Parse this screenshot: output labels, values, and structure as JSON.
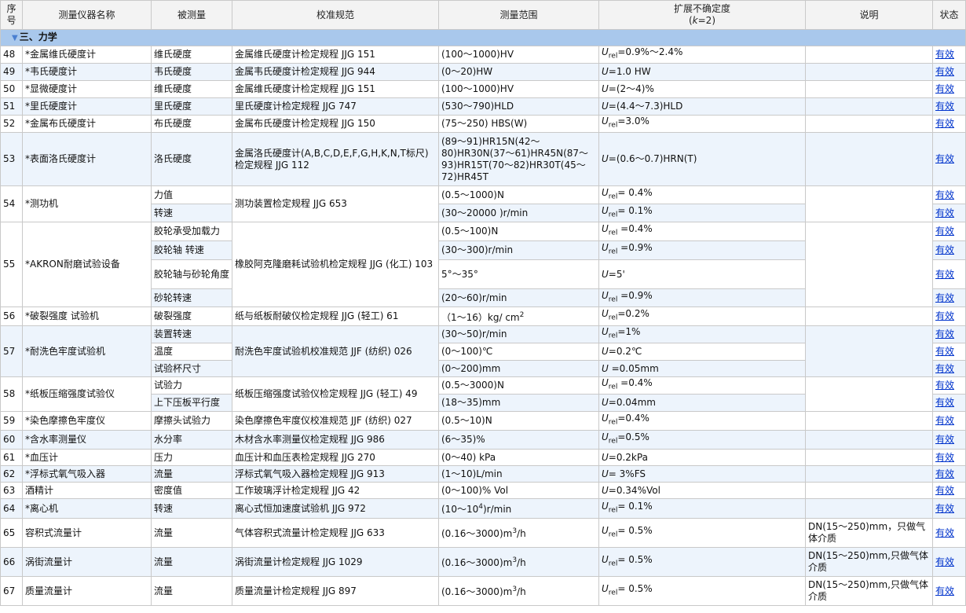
{
  "headers": [
    "序号",
    "测量仪器名称",
    "被测量",
    "校准规范",
    "测量范围",
    "扩展不确定度",
    "(k=2)",
    "说明",
    "状态"
  ],
  "section": "三、力学",
  "status_link": "有效",
  "rows": {
    "r48": {
      "no": "48",
      "name": "*金属维氏硬度计",
      "qty": "维氏硬度",
      "spec": "金属维氏硬度计检定规程 JJG 151",
      "range": "(100～1000)HV",
      "u": "=0.9%～2.4%"
    },
    "r49": {
      "no": "49",
      "name": "*韦氏硬度计",
      "qty": "韦氏硬度",
      "spec": "金属韦氏硬度计检定规程 JJG 944",
      "range": "(0～20)HW",
      "u": "=1.0 HW"
    },
    "r50": {
      "no": "50",
      "name": "*显微硬度计",
      "qty": "维氏硬度",
      "spec": "金属维氏硬度计检定规程 JJG 151",
      "range": "(100～1000)HV",
      "u": "=(2～4)%"
    },
    "r51": {
      "no": "51",
      "name": "*里氏硬度计",
      "qty": "里氏硬度",
      "spec": "里氏硬度计检定规程 JJG 747",
      "range": "(530～790)HLD",
      "u": "=(4.4～7.3)HLD"
    },
    "r52": {
      "no": "52",
      "name": "*金属布氏硬度计",
      "qty": "布氏硬度",
      "spec": "金属布氏硬度计检定规程 JJG 150",
      "range": "(75～250) HBS(W)",
      "u": "=3.0%"
    },
    "r53": {
      "no": "53",
      "name": "*表面洛氏硬度计",
      "qty": "洛氏硬度",
      "spec": "金属洛氏硬度计(A,B,C,D,E,F,G,H,K,N,T标尺)检定规程 JJG 112",
      "range": "(89～91)HR15N(42～80)HR30N(37～61)HR45N(87～93)HR15T(70～82)HR30T(45～72)HR45T",
      "u": "=(0.6～0.7)HRN(T)"
    },
    "r54": {
      "no": "54",
      "name": "*测功机",
      "spec": "测功装置检定规程 JJG 653",
      "subs": [
        {
          "qty": "力值",
          "range": "(0.5～1000)N",
          "u": "= 0.4%"
        },
        {
          "qty": "转速",
          "range": "(30～20000 )r/min",
          "u": "= 0.1%"
        }
      ]
    },
    "r55": {
      "no": "55",
      "name": "*AKRON耐磨试验设备",
      "spec": "橡胶阿克隆磨耗试验机检定规程 JJG (化工) 103",
      "subs": [
        {
          "qty": "胶轮承受加载力",
          "range": "(0.5～100)N",
          "u": " =0.4%"
        },
        {
          "qty": "胶轮轴 转速",
          "range": "(30～300)r/min",
          "u": " =0.9%"
        },
        {
          "qty": "胶轮轴与砂轮角度",
          "range": "5°～35°",
          "u": "=5'"
        },
        {
          "qty": "砂轮转速",
          "range": "(20～60)r/min",
          "u": " =0.9%"
        }
      ]
    },
    "r56": {
      "no": "56",
      "name": "*破裂强度 试验机",
      "qty": "破裂强度",
      "spec": "纸与纸板耐破仪检定规程 JJG (轻工) 61",
      "range": "（1～16）kg/ cm",
      "u": "=0.2%"
    },
    "r57": {
      "no": "57",
      "name": "*耐洗色牢度试验机",
      "spec": "耐洗色牢度试验机校准规范 JJF (纺织) 026",
      "subs": [
        {
          "qty": "装置转速",
          "range": "(30～50)r/min",
          "u": "=1%"
        },
        {
          "qty": "温度",
          "range": "(0～100)℃",
          "u": "=0.2℃"
        },
        {
          "qty": "试验杯尺寸",
          "range": "(0～200)mm",
          "u": " =0.05mm"
        }
      ]
    },
    "r58": {
      "no": "58",
      "name": "*纸板压缩强度试验仪",
      "spec": "纸板压缩强度试验仪检定规程 JJG (轻工) 49",
      "subs": [
        {
          "qty": "试验力",
          "range": "(0.5～3000)N",
          "u": " =0.4%"
        },
        {
          "qty": "上下压板平行度",
          "range": "(18～35)mm",
          "u": "=0.04mm"
        }
      ]
    },
    "r59": {
      "no": "59",
      "name": "*染色摩擦色牢度仪",
      "qty": "摩擦头试验力",
      "spec": "染色摩擦色牢度仪校准规范 JJF (纺织) 027",
      "range": "(0.5～10)N",
      "u": "=0.4%"
    },
    "r60": {
      "no": "60",
      "name": "*含水率测量仪",
      "qty": "水分率",
      "spec": "木材含水率测量仪检定规程 JJG 986",
      "range": "(6～35)%",
      "u": "=0.5%"
    },
    "r61": {
      "no": "61",
      "name": "*血压计",
      "qty": "压力",
      "spec": "血压计和血压表检定规程 JJG 270",
      "range": "(0～40) kPa",
      "u": "=0.2kPa"
    },
    "r62": {
      "no": "62",
      "name": "*浮标式氧气吸入器",
      "qty": "流量",
      "spec": "浮标式氧气吸入器检定规程 JJG 913",
      "range": "(1～10)L/min",
      "u": "= 3%FS"
    },
    "r63": {
      "no": "63",
      "name": "酒精计",
      "qty": "密度值",
      "spec": "工作玻璃浮计检定规程 JJG 42",
      "range": "(0～100)% Vol",
      "u": "=0.34%Vol"
    },
    "r64": {
      "no": "64",
      "name": "*离心机",
      "qty": "转速",
      "spec": "离心式恒加速度试验机 JJG 972",
      "range_a": "(10～10",
      "range_b": ")r/min",
      "u": "= 0.1%"
    },
    "r65": {
      "no": "65",
      "name": "容积式流量计",
      "qty": "流量",
      "spec": "气体容积式流量计检定规程 JJG 633",
      "range_a": "(0.16～3000)m",
      "range_b": "/h",
      "u": "= 0.5%",
      "note": "DN(15～250)mm，只做气体介质"
    },
    "r66": {
      "no": "66",
      "name": "涡街流量计",
      "qty": "流量",
      "spec": "涡街流量计检定规程 JJG 1029",
      "range_a": "(0.16～3000)m",
      "range_b": "/h",
      "u": "= 0.5%",
      "note": "DN(15～250)mm,只做气体介质"
    },
    "r67": {
      "no": "67",
      "name": "质量流量计",
      "qty": "流量",
      "spec": "质量流量计检定规程 JJG 897",
      "range_a": "(0.16～3000)m",
      "range_b": "/h",
      "u": "= 0.5%",
      "note": "DN(15～250)mm,只做气体介质"
    }
  },
  "sym": {
    "U": "U",
    "rel": "rel",
    "k": "k",
    "sup2": "2",
    "sup3": "3",
    "sup4": "4"
  }
}
